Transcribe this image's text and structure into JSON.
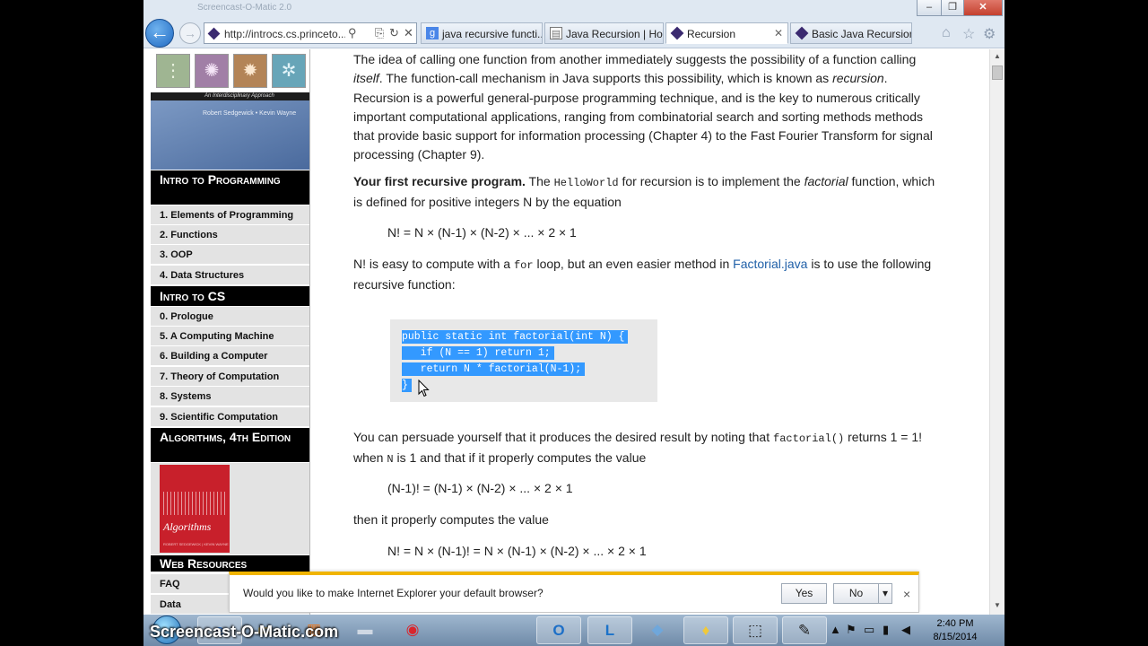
{
  "browser": {
    "window_title_ghost": "Screencast-O-Matic 2.0",
    "address_url": "http://introcs.cs.princeto...",
    "tabs": [
      {
        "label": "java recursive functi...",
        "icon": "google-g-icon",
        "active": false
      },
      {
        "label": "Java Recursion | Ho...",
        "icon": "document-icon",
        "active": false
      },
      {
        "label": "Recursion",
        "icon": "princeton-diamond-icon",
        "active": true
      },
      {
        "label": "Basic Java Recursion...",
        "icon": "princeton-diamond-icon",
        "active": false
      }
    ],
    "window_controls": {
      "minimize": "–",
      "restore": "❐",
      "close": "✕"
    },
    "nav": {
      "back_glyph": "←",
      "forward_glyph": "→"
    },
    "address_icons": {
      "search": "⚲",
      "compat": "⎘",
      "refresh": "↻",
      "stop": "✕"
    },
    "toolbar_icons": {
      "home": "⌂",
      "favorites": "☆",
      "tools": "⚙"
    }
  },
  "sidebar": {
    "book_subtitle": "An Interdisciplinary Approach",
    "book_authors": "Robert Sedgewick • Kevin Wayne",
    "sections": [
      {
        "heading": "Intro to Programming",
        "items": [
          "1.  Elements of Programming",
          "2.  Functions",
          "3.  OOP",
          "4.  Data Structures"
        ]
      },
      {
        "heading": "Intro to CS",
        "items": [
          "0.  Prologue",
          "5.  A Computing Machine",
          "6.  Building a Computer",
          "7.  Theory of Computation",
          "8.  Systems",
          "9.  Scientific Computation"
        ]
      },
      {
        "heading": "Algorithms, 4th Edition",
        "items": []
      },
      {
        "heading": "Web Resources",
        "items": [
          "FAQ",
          "Data"
        ]
      }
    ],
    "algorithms_cover_title": "Algorithms",
    "algorithms_cover_authors": "ROBERT SEDGEWICK | KEVIN WAYNE"
  },
  "content": {
    "p1_a": "The idea of calling one function from another immediately suggests the possibility of a function calling ",
    "p1_em1": "itself",
    "p1_b": ". The function-call mechanism in Java supports this possibility, which is known as ",
    "p1_em2": "recursion",
    "p1_c": ". Recursion is a powerful general-purpose programming technique, and is the key to numerous critically important computational applications, ranging from combinatorial search and sorting methods methods that provide basic support for information processing (Chapter 4) to the Fast Fourier Transform for signal processing (Chapter 9).",
    "p2_bold": "Your first recursive program.",
    "p2_a": " The ",
    "p2_code": "HelloWorld",
    "p2_b": " for recursion is to implement the ",
    "p2_em": "factorial",
    "p2_c": " function, which is defined for positive integers N by the equation",
    "eq1": "N! = N × (N-1) × (N-2) × ... × 2 × 1",
    "p3_a": "N! is easy to compute with a ",
    "p3_code": "for",
    "p3_b": " loop, but an even easier method in ",
    "p3_link": "Factorial.java",
    "p3_c": " is to use the following recursive function:",
    "code_lines": [
      "public static int factorial(int N) {",
      "   if (N == 1) return 1;",
      "   return N * factorial(N-1);",
      "}"
    ],
    "p4_a": "You can persuade yourself that it produces the desired result by noting that ",
    "p4_code1": "factorial()",
    "p4_b": " returns 1 = 1! when ",
    "p4_code2": "N",
    "p4_c": " is 1 and that if it properly computes the value",
    "eq2": "(N-1)! = (N-1) × (N-2) × ... × 2 × 1",
    "p5": "then it properly computes the value",
    "eq3": "N! = N × (N-1)! = N × (N-1) × (N-2) × ... × 2 × 1"
  },
  "notification": {
    "message": "Would you like to make Internet Explorer your default browser?",
    "yes_label": "Yes",
    "no_label": "No",
    "dropdown_glyph": "▾",
    "close_glyph": "×"
  },
  "taskbar": {
    "watermark": "Screencast-O-Matic.com",
    "clock_time": "2:40 PM",
    "clock_date": "8/15/2014"
  }
}
